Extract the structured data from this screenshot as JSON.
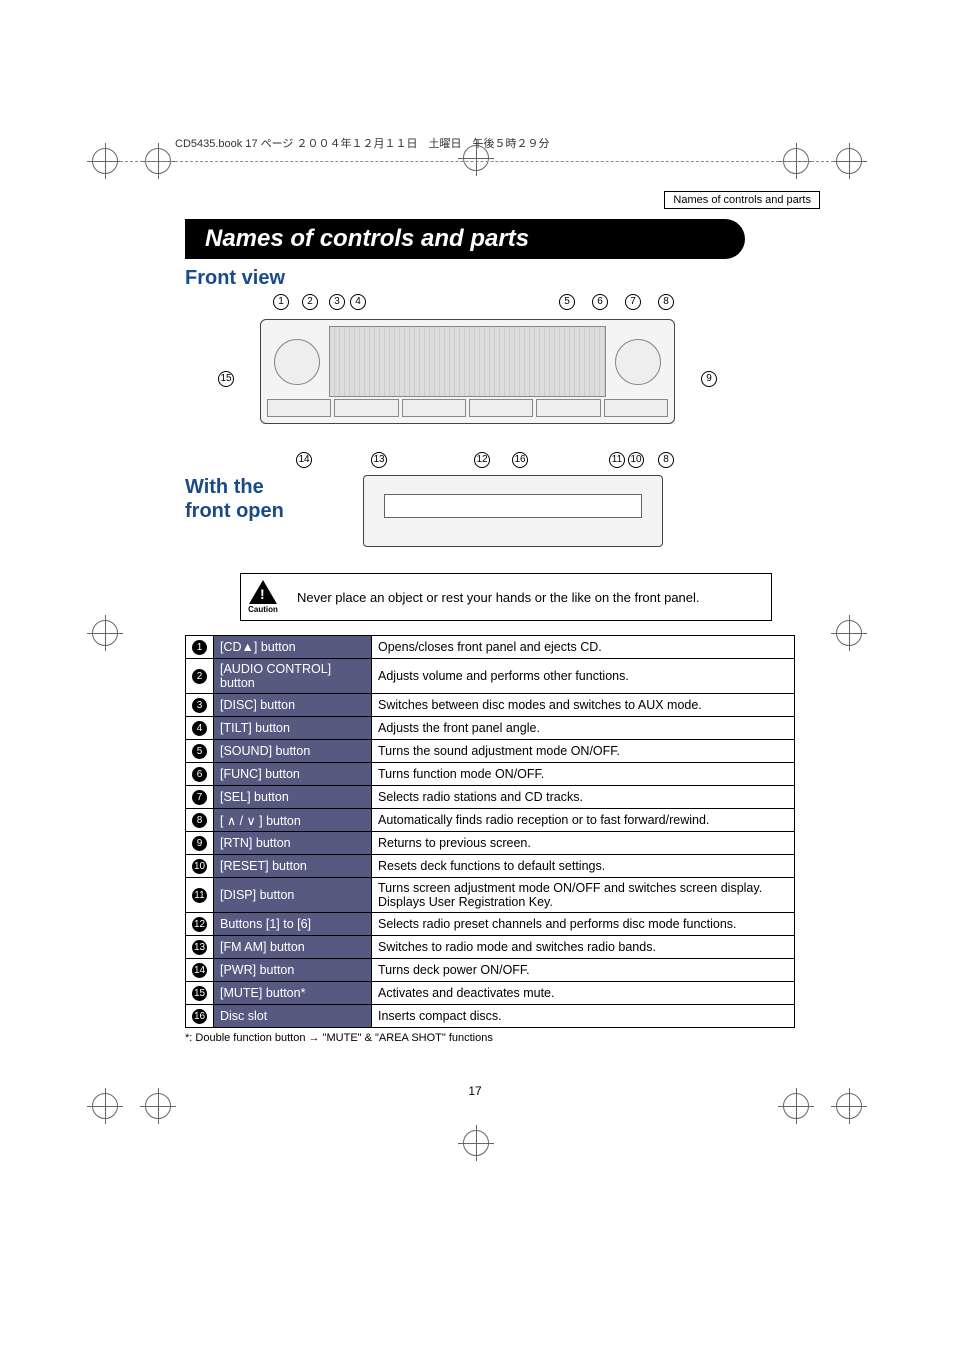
{
  "header_line": "CD5435.book  17 ページ  ２００４年１２月１１日　土曜日　午後５時２９分",
  "breadcrumb": "Names of controls and parts",
  "title": "Names of controls and parts",
  "section_front": "Front view",
  "section_open_l1": "With the",
  "section_open_l2": "front open",
  "caution_label": "Caution",
  "caution_text": "Never place an object or rest your hands or the like on the front panel.",
  "footnote": "*: Double function button → \"MUTE\" & \"AREA SHOT\" functions",
  "page_number": "17",
  "callouts_top": [
    "1",
    "2",
    "3",
    "4",
    "5",
    "6",
    "7",
    "8"
  ],
  "callouts_side_right": "9",
  "callouts_side_left": "15",
  "callouts_bottom": [
    "14",
    "13",
    "12",
    "16",
    "11",
    "10",
    "8"
  ],
  "controls": [
    {
      "num": "1",
      "name": "[CD▲] button",
      "desc": "Opens/closes front panel and ejects CD."
    },
    {
      "num": "2",
      "name": "[AUDIO CONTROL] button",
      "desc": "Adjusts volume and performs other functions."
    },
    {
      "num": "3",
      "name": "[DISC] button",
      "desc": "Switches between disc modes and switches to AUX mode."
    },
    {
      "num": "4",
      "name": "[TILT] button",
      "desc": "Adjusts the front panel angle."
    },
    {
      "num": "5",
      "name": "[SOUND] button",
      "desc": "Turns the sound adjustment mode ON/OFF."
    },
    {
      "num": "6",
      "name": "[FUNC] button",
      "desc": "Turns function mode ON/OFF."
    },
    {
      "num": "7",
      "name": "[SEL] button",
      "desc": "Selects radio stations and CD tracks."
    },
    {
      "num": "8",
      "name": "[ ∧ / ∨ ] button",
      "desc": "Automatically finds radio reception or to fast forward/rewind."
    },
    {
      "num": "9",
      "name": "[RTN] button",
      "desc": "Returns to previous screen."
    },
    {
      "num": "10",
      "name": "[RESET] button",
      "desc": "Resets deck functions to default settings."
    },
    {
      "num": "11",
      "name": "[DISP] button",
      "desc": "Turns screen adjustment mode ON/OFF and switches screen display. Displays User Registration Key."
    },
    {
      "num": "12",
      "name": "Buttons [1] to [6]",
      "desc": "Selects radio preset channels and performs disc mode functions."
    },
    {
      "num": "13",
      "name": "[FM AM] button",
      "desc": "Switches to radio mode and switches radio bands."
    },
    {
      "num": "14",
      "name": "[PWR] button",
      "desc": "Turns deck power ON/OFF."
    },
    {
      "num": "15",
      "name": "[MUTE] button*",
      "desc": "Activates and deactivates mute."
    },
    {
      "num": "16",
      "name": "Disc slot",
      "desc": "Inserts compact discs."
    }
  ]
}
